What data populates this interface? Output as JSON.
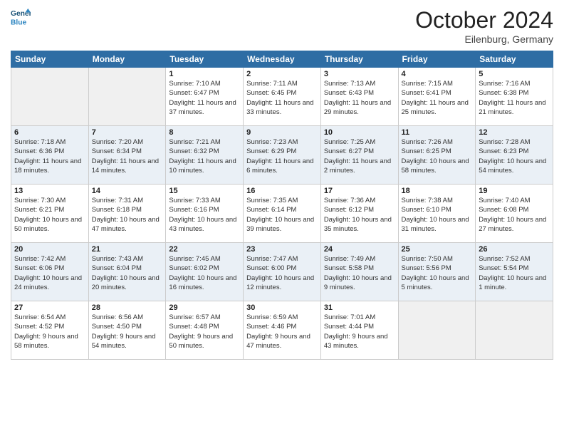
{
  "header": {
    "logo_line1": "General",
    "logo_line2": "Blue",
    "month": "October 2024",
    "location": "Eilenburg, Germany"
  },
  "days_of_week": [
    "Sunday",
    "Monday",
    "Tuesday",
    "Wednesday",
    "Thursday",
    "Friday",
    "Saturday"
  ],
  "weeks": [
    [
      {
        "day": "",
        "sunrise": "",
        "sunset": "",
        "daylight": "",
        "empty": true
      },
      {
        "day": "",
        "sunrise": "",
        "sunset": "",
        "daylight": "",
        "empty": true
      },
      {
        "day": "1",
        "sunrise": "Sunrise: 7:10 AM",
        "sunset": "Sunset: 6:47 PM",
        "daylight": "Daylight: 11 hours and 37 minutes.",
        "empty": false
      },
      {
        "day": "2",
        "sunrise": "Sunrise: 7:11 AM",
        "sunset": "Sunset: 6:45 PM",
        "daylight": "Daylight: 11 hours and 33 minutes.",
        "empty": false
      },
      {
        "day": "3",
        "sunrise": "Sunrise: 7:13 AM",
        "sunset": "Sunset: 6:43 PM",
        "daylight": "Daylight: 11 hours and 29 minutes.",
        "empty": false
      },
      {
        "day": "4",
        "sunrise": "Sunrise: 7:15 AM",
        "sunset": "Sunset: 6:41 PM",
        "daylight": "Daylight: 11 hours and 25 minutes.",
        "empty": false
      },
      {
        "day": "5",
        "sunrise": "Sunrise: 7:16 AM",
        "sunset": "Sunset: 6:38 PM",
        "daylight": "Daylight: 11 hours and 21 minutes.",
        "empty": false
      }
    ],
    [
      {
        "day": "6",
        "sunrise": "Sunrise: 7:18 AM",
        "sunset": "Sunset: 6:36 PM",
        "daylight": "Daylight: 11 hours and 18 minutes.",
        "empty": false
      },
      {
        "day": "7",
        "sunrise": "Sunrise: 7:20 AM",
        "sunset": "Sunset: 6:34 PM",
        "daylight": "Daylight: 11 hours and 14 minutes.",
        "empty": false
      },
      {
        "day": "8",
        "sunrise": "Sunrise: 7:21 AM",
        "sunset": "Sunset: 6:32 PM",
        "daylight": "Daylight: 11 hours and 10 minutes.",
        "empty": false
      },
      {
        "day": "9",
        "sunrise": "Sunrise: 7:23 AM",
        "sunset": "Sunset: 6:29 PM",
        "daylight": "Daylight: 11 hours and 6 minutes.",
        "empty": false
      },
      {
        "day": "10",
        "sunrise": "Sunrise: 7:25 AM",
        "sunset": "Sunset: 6:27 PM",
        "daylight": "Daylight: 11 hours and 2 minutes.",
        "empty": false
      },
      {
        "day": "11",
        "sunrise": "Sunrise: 7:26 AM",
        "sunset": "Sunset: 6:25 PM",
        "daylight": "Daylight: 10 hours and 58 minutes.",
        "empty": false
      },
      {
        "day": "12",
        "sunrise": "Sunrise: 7:28 AM",
        "sunset": "Sunset: 6:23 PM",
        "daylight": "Daylight: 10 hours and 54 minutes.",
        "empty": false
      }
    ],
    [
      {
        "day": "13",
        "sunrise": "Sunrise: 7:30 AM",
        "sunset": "Sunset: 6:21 PM",
        "daylight": "Daylight: 10 hours and 50 minutes.",
        "empty": false
      },
      {
        "day": "14",
        "sunrise": "Sunrise: 7:31 AM",
        "sunset": "Sunset: 6:18 PM",
        "daylight": "Daylight: 10 hours and 47 minutes.",
        "empty": false
      },
      {
        "day": "15",
        "sunrise": "Sunrise: 7:33 AM",
        "sunset": "Sunset: 6:16 PM",
        "daylight": "Daylight: 10 hours and 43 minutes.",
        "empty": false
      },
      {
        "day": "16",
        "sunrise": "Sunrise: 7:35 AM",
        "sunset": "Sunset: 6:14 PM",
        "daylight": "Daylight: 10 hours and 39 minutes.",
        "empty": false
      },
      {
        "day": "17",
        "sunrise": "Sunrise: 7:36 AM",
        "sunset": "Sunset: 6:12 PM",
        "daylight": "Daylight: 10 hours and 35 minutes.",
        "empty": false
      },
      {
        "day": "18",
        "sunrise": "Sunrise: 7:38 AM",
        "sunset": "Sunset: 6:10 PM",
        "daylight": "Daylight: 10 hours and 31 minutes.",
        "empty": false
      },
      {
        "day": "19",
        "sunrise": "Sunrise: 7:40 AM",
        "sunset": "Sunset: 6:08 PM",
        "daylight": "Daylight: 10 hours and 27 minutes.",
        "empty": false
      }
    ],
    [
      {
        "day": "20",
        "sunrise": "Sunrise: 7:42 AM",
        "sunset": "Sunset: 6:06 PM",
        "daylight": "Daylight: 10 hours and 24 minutes.",
        "empty": false
      },
      {
        "day": "21",
        "sunrise": "Sunrise: 7:43 AM",
        "sunset": "Sunset: 6:04 PM",
        "daylight": "Daylight: 10 hours and 20 minutes.",
        "empty": false
      },
      {
        "day": "22",
        "sunrise": "Sunrise: 7:45 AM",
        "sunset": "Sunset: 6:02 PM",
        "daylight": "Daylight: 10 hours and 16 minutes.",
        "empty": false
      },
      {
        "day": "23",
        "sunrise": "Sunrise: 7:47 AM",
        "sunset": "Sunset: 6:00 PM",
        "daylight": "Daylight: 10 hours and 12 minutes.",
        "empty": false
      },
      {
        "day": "24",
        "sunrise": "Sunrise: 7:49 AM",
        "sunset": "Sunset: 5:58 PM",
        "daylight": "Daylight: 10 hours and 9 minutes.",
        "empty": false
      },
      {
        "day": "25",
        "sunrise": "Sunrise: 7:50 AM",
        "sunset": "Sunset: 5:56 PM",
        "daylight": "Daylight: 10 hours and 5 minutes.",
        "empty": false
      },
      {
        "day": "26",
        "sunrise": "Sunrise: 7:52 AM",
        "sunset": "Sunset: 5:54 PM",
        "daylight": "Daylight: 10 hours and 1 minute.",
        "empty": false
      }
    ],
    [
      {
        "day": "27",
        "sunrise": "Sunrise: 6:54 AM",
        "sunset": "Sunset: 4:52 PM",
        "daylight": "Daylight: 9 hours and 58 minutes.",
        "empty": false
      },
      {
        "day": "28",
        "sunrise": "Sunrise: 6:56 AM",
        "sunset": "Sunset: 4:50 PM",
        "daylight": "Daylight: 9 hours and 54 minutes.",
        "empty": false
      },
      {
        "day": "29",
        "sunrise": "Sunrise: 6:57 AM",
        "sunset": "Sunset: 4:48 PM",
        "daylight": "Daylight: 9 hours and 50 minutes.",
        "empty": false
      },
      {
        "day": "30",
        "sunrise": "Sunrise: 6:59 AM",
        "sunset": "Sunset: 4:46 PM",
        "daylight": "Daylight: 9 hours and 47 minutes.",
        "empty": false
      },
      {
        "day": "31",
        "sunrise": "Sunrise: 7:01 AM",
        "sunset": "Sunset: 4:44 PM",
        "daylight": "Daylight: 9 hours and 43 minutes.",
        "empty": false
      },
      {
        "day": "",
        "sunrise": "",
        "sunset": "",
        "daylight": "",
        "empty": true
      },
      {
        "day": "",
        "sunrise": "",
        "sunset": "",
        "daylight": "",
        "empty": true
      }
    ]
  ]
}
